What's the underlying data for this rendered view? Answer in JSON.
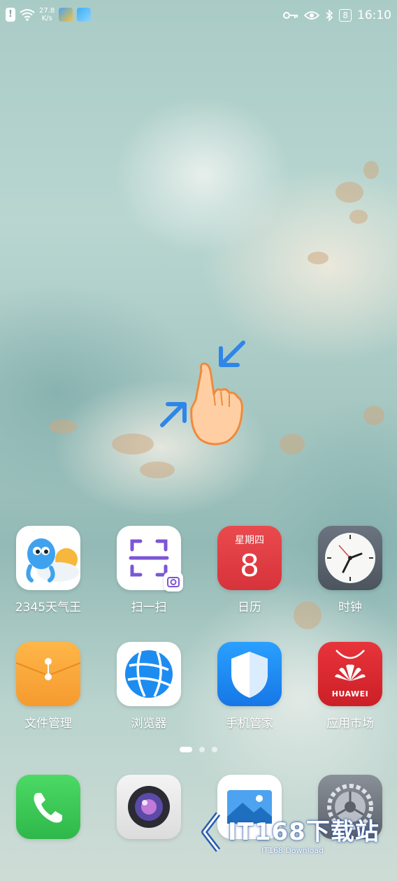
{
  "status_bar": {
    "network_speed_value": "27.8",
    "network_speed_unit": "K/s",
    "battery": "8",
    "time": "16:10",
    "icons": [
      "alert-icon",
      "wifi-icon",
      "notification-app-icon",
      "notification-app-icon",
      "key-icon",
      "eye-icon",
      "bluetooth-icon",
      "battery-icon"
    ]
  },
  "home_apps": [
    {
      "label": "2345天气王",
      "icon": "weather-app-icon"
    },
    {
      "label": "扫一扫",
      "icon": "scan-icon"
    },
    {
      "label": "日历",
      "icon": "calendar-icon",
      "weekday": "星期四",
      "day": "8"
    },
    {
      "label": "时钟",
      "icon": "clock-icon"
    },
    {
      "label": "文件管理",
      "icon": "folder-icon"
    },
    {
      "label": "浏览器",
      "icon": "browser-icon"
    },
    {
      "label": "手机管家",
      "icon": "shield-icon"
    },
    {
      "label": "应用市场",
      "icon": "app-market-icon",
      "brand": "HUAWEI"
    }
  ],
  "page_indicator": {
    "count": 3,
    "active": 1
  },
  "dock": [
    {
      "icon": "phone-icon"
    },
    {
      "icon": "camera-icon"
    },
    {
      "icon": "gallery-icon"
    },
    {
      "icon": "settings-icon"
    }
  ],
  "watermark": {
    "title": "IT168下载站",
    "subtitle": "IT168 Download"
  },
  "colors": {
    "calendar_red": "#e23b3f",
    "market_red": "#d8262e",
    "shield_blue": "#1e86f0",
    "folder_orange": "#f7a33a",
    "phone_green": "#34c759"
  }
}
